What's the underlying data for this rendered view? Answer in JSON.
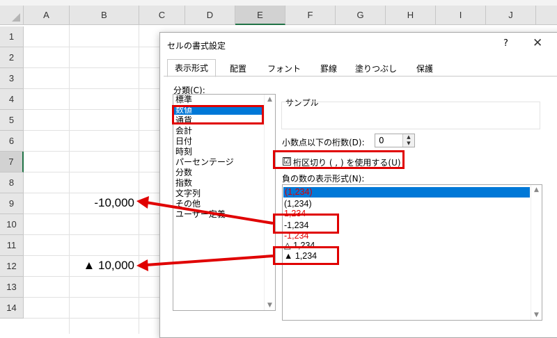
{
  "sheet": {
    "columns": [
      "A",
      "B",
      "C",
      "D",
      "E",
      "F",
      "G",
      "H",
      "I",
      "J"
    ],
    "selected_column": "E",
    "rows": [
      "1",
      "2",
      "3",
      "4",
      "5",
      "6",
      "7",
      "8",
      "9",
      "10",
      "11",
      "12",
      "13",
      "14"
    ],
    "selected_row": "7",
    "cells": {
      "B9": "-10,000",
      "B12": "▲ 10,000"
    }
  },
  "dialog": {
    "title": "セルの書式設定",
    "help": "?",
    "close": "✕",
    "tabs": [
      "表示形式",
      "配置",
      "フォント",
      "罫線",
      "塗りつぶし",
      "保護"
    ],
    "active_tab": "表示形式",
    "category_label": "分類(C):",
    "categories": [
      "標準",
      "数値",
      "通貨",
      "会計",
      "日付",
      "時刻",
      "パーセンテージ",
      "分数",
      "指数",
      "文字列",
      "その他",
      "ユーザー定義"
    ],
    "selected_category": "数値",
    "sample_label": "サンプル",
    "decimals_label": "小数点以下の桁数(D):",
    "decimals_value": "0",
    "thousands_label": "桁区切り ( , ) を使用する(U)",
    "thousands_checked": "☑",
    "negative_label": "負の数の表示形式(N):",
    "negative_formats": [
      {
        "text": "(1,234)",
        "color": "#e00000",
        "selected": true
      },
      {
        "text": "(1,234)",
        "color": "#000000"
      },
      {
        "text": "1,234",
        "color": "#e00000"
      },
      {
        "text": "-1,234",
        "color": "#000000"
      },
      {
        "text": "-1,234",
        "color": "#e00000"
      },
      {
        "text": "△ 1,234",
        "color": "#000000"
      },
      {
        "text": "▲ 1,234",
        "color": "#000000"
      }
    ]
  },
  "colors": {
    "annotation": "#e00000",
    "selection": "#0078d7",
    "excel_green": "#217346"
  }
}
